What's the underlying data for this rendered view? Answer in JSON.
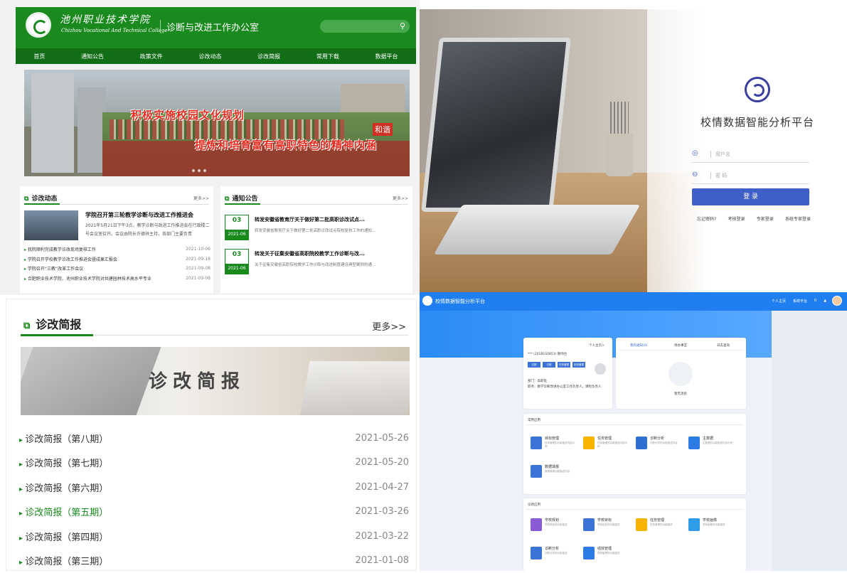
{
  "site": {
    "college_name": "池州职业技术学院",
    "college_name_en": "Chizhou Vocational And Technical College",
    "office": "诊断与改进工作办公室",
    "nav": [
      "首页",
      "通知公告",
      "政策文件",
      "诊改动态",
      "诊改简报",
      "常用下载",
      "数据平台"
    ],
    "banner_text_1": "积极实施校园文化规划",
    "banner_text_2": "提炼和培育富有高职特色的精神内涵",
    "banner_text_3": "和谐",
    "news": {
      "title": "诊改动态",
      "more": "更多>>",
      "feature_title": "学院召开第三轮教学诊断与改进工作推进会",
      "feature_desc": "2021年5月21日下午3点，教学诊断与改进工作推进会在行政楼二号会议室召开。会议由院长许德祥主持，各部门主要负责",
      "items": [
        {
          "title": "我院顺利完成教学诊改现场复核工作",
          "date": "2021-10-06"
        },
        {
          "title": "学院召开学校教学诊改工作推进会暨成果汇报会",
          "date": "2021-09-18"
        },
        {
          "title": "学院召开“三教”改革工作会议",
          "date": "2021-09-08"
        },
        {
          "title": "合肥职业技术学院、池州职业技术学院对共建园林技术高水平专业",
          "date": "2021-09-08"
        }
      ]
    },
    "notices": {
      "title": "通知公告",
      "more": "更多>>",
      "items": [
        {
          "day": "03",
          "month": "2021-06",
          "title": "转发安徽省教育厅关于做好第二批高职诊改试点...",
          "desc": "转发安徽省教育厅关于做好第二批高职诊改试点院校复核工作的通知..."
        },
        {
          "day": "03",
          "month": "2021-06",
          "title": "转发关于征集安徽省高职院校教学工作诊断与改...",
          "desc": "关于征集安徽省高职院校教学工作诊断与改进制度建设典型案例的通..."
        }
      ]
    }
  },
  "login": {
    "title": "校情数据智能分析平台",
    "username_placeholder": "用户名",
    "password_placeholder": "密 码",
    "login_button": "登 录",
    "links": [
      "忘记密码?",
      "考核登录",
      "专家登录",
      "系统专家登录"
    ]
  },
  "briefs": {
    "title": "诊改简报",
    "more": "更多>>",
    "banner_text": "诊改简报",
    "items": [
      {
        "title": "诊改简报（第八期）",
        "date": "2021-05-26"
      },
      {
        "title": "诊改简报（第七期）",
        "date": "2021-05-20"
      },
      {
        "title": "诊改简报（第六期）",
        "date": "2021-04-27"
      },
      {
        "title": "诊改简报（第五期）",
        "date": "2021-03-26"
      },
      {
        "title": "诊改简报（第四期）",
        "date": "2021-03-22"
      },
      {
        "title": "诊改简报（第三期）",
        "date": "2021-01-08"
      }
    ]
  },
  "dashboard": {
    "title": "校情数据智能分析平台",
    "header_right": [
      "个人主页",
      "系统平台",
      "0"
    ],
    "user": {
      "id_line": "*** (20181S0851)  教师台",
      "role_label": "个人主页>",
      "tags": [
        "日报",
        "日程",
        "任务管理",
        "知识管理"
      ],
      "dept": "部门：高职处",
      "job": "职务：教学诊断改进办公室工作负责人，课程负责人"
    },
    "tabs": [
      "我的通知(0)",
      "待办事宜",
      "日志查询"
    ],
    "empty_label": "暂无消息",
    "common_apps_title": "常用应用",
    "common_apps": [
      {
        "name": "目标管理",
        "desc": "目标管理的功能描述内容示例",
        "color": "#3b73d6"
      },
      {
        "name": "任务管理",
        "desc": "任务管理的功能描述内容示例",
        "color": "#f6b400"
      },
      {
        "name": "诊断分析",
        "desc": "诊断分析的功能描述内容",
        "color": "#2f6fd1"
      },
      {
        "name": "主数据",
        "desc": "主数据的功能描述内容示例",
        "color": "#2d7be5"
      },
      {
        "name": "数据填报",
        "desc": "数据填报功能描述内容",
        "color": "#3b73d6"
      }
    ],
    "biz_apps_title": "诊改应用",
    "biz_apps": [
      {
        "name": "学校规划",
        "desc": "学校规划的功能描述",
        "color": "#8a5bd6"
      },
      {
        "name": "学校目标",
        "desc": "学校目标的功能描述",
        "color": "#3b73d6"
      },
      {
        "name": "任务管理",
        "desc": "任务管理的功能描述",
        "color": "#f6b400"
      },
      {
        "name": "学校画像",
        "desc": "学校画像的功能描述",
        "color": "#2d9be5"
      },
      {
        "name": "诊断分析",
        "desc": "诊断分析的功能描述",
        "color": "#3b73d6"
      },
      {
        "name": "绩效管理",
        "desc": "绩效管理的功能描述",
        "color": "#2d7be5"
      }
    ]
  }
}
